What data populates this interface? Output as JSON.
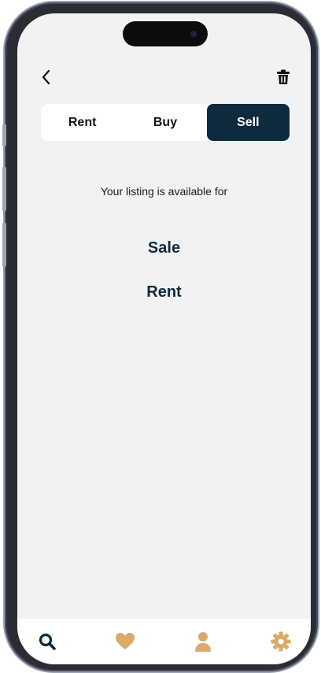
{
  "header": {
    "back_icon": "chevron-left-icon",
    "delete_icon": "trash-icon"
  },
  "segments": [
    {
      "label": "Rent",
      "active": false
    },
    {
      "label": "Buy",
      "active": false
    },
    {
      "label": "Sell",
      "active": true
    }
  ],
  "listing": {
    "subtitle": "Your listing is available for",
    "options": [
      "Sale",
      "Rent"
    ]
  },
  "tabbar": {
    "items": [
      {
        "icon": "search-icon",
        "active": true
      },
      {
        "icon": "heart-icon",
        "active": false
      },
      {
        "icon": "user-icon",
        "active": false
      },
      {
        "icon": "gear-icon",
        "active": false
      }
    ]
  },
  "colors": {
    "primary": "#0e2a3d",
    "accent": "#d9aa6a",
    "background": "#f2f2f2"
  }
}
